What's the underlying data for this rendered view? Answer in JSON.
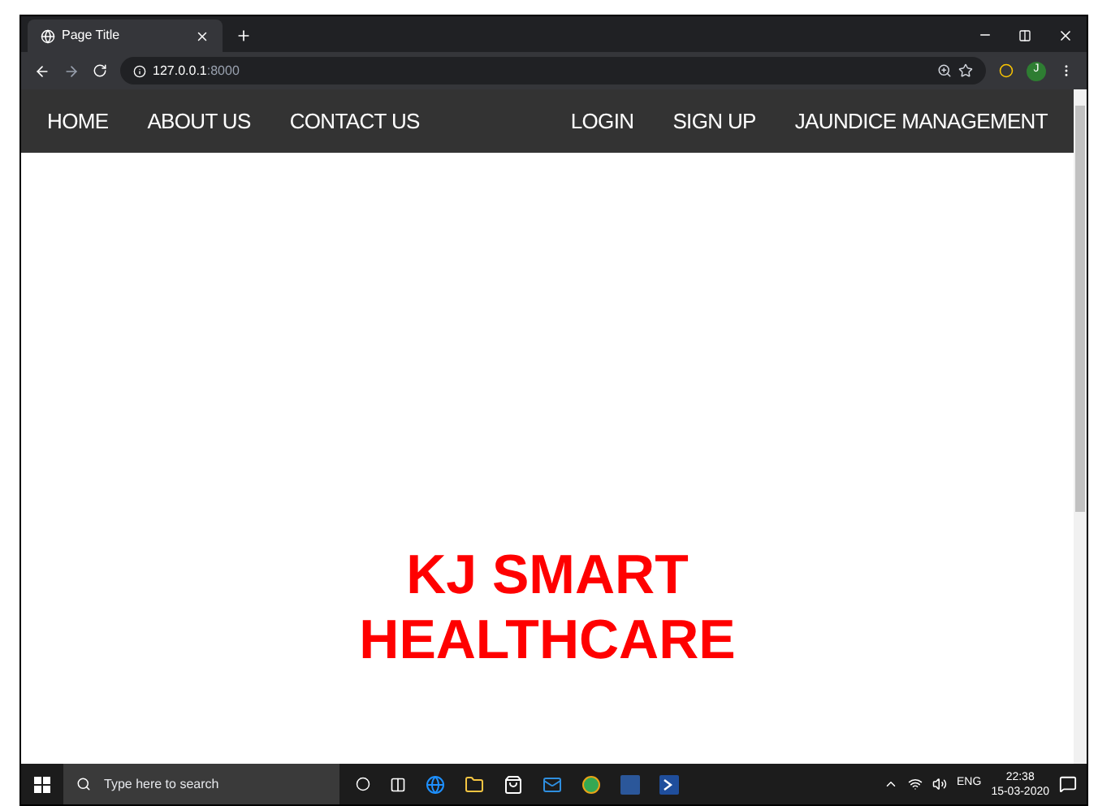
{
  "browser": {
    "tab_title": "Page Title",
    "url_host": "127.0.0.1",
    "url_port": ":8000",
    "avatar_letter": "J"
  },
  "nav": {
    "left": [
      "HOME",
      "ABOUT US",
      "CONTACT US"
    ],
    "right": [
      "LOGIN",
      "SIGN UP",
      "JAUNDICE MANAGEMENT"
    ]
  },
  "hero": {
    "title_lines": [
      "KJ SMART",
      "HEALTHCARE"
    ]
  },
  "taskbar": {
    "search_placeholder": "Type here to search",
    "language": "ENG",
    "time": "22:38",
    "date": "15-03-2020"
  }
}
